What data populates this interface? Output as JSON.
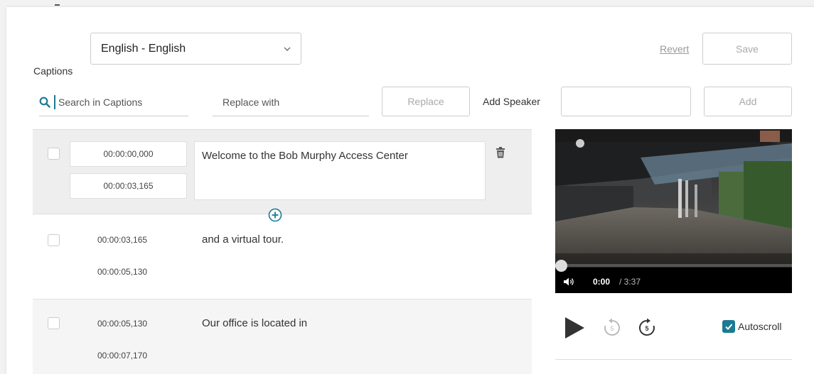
{
  "header": {
    "captions_label": "Captions",
    "language_selected": "English - English",
    "revert_label": "Revert",
    "save_label": "Save"
  },
  "toolbar": {
    "search_placeholder": "Search in Captions",
    "replace_placeholder": "Replace with",
    "replace_label": "Replace",
    "add_speaker_label": "Add Speaker",
    "add_label": "Add"
  },
  "captions": [
    {
      "start": "00:00:00,000",
      "end": "00:00:03,165",
      "text": "Welcome to the Bob Murphy Access Center"
    },
    {
      "start": "00:00:03,165",
      "end": "00:00:05,130",
      "text": "and a virtual tour."
    },
    {
      "start": "00:00:05,130",
      "end": "00:00:07,170",
      "text": "Our office is located in"
    }
  ],
  "player": {
    "current_time": "0:00",
    "total_time": "/ 3:37",
    "progress": 0,
    "autoscroll_label": "Autoscroll",
    "autoscroll_checked": true,
    "rewind_seconds": "5",
    "forward_seconds": "5"
  },
  "colors": {
    "accent": "#1b7a94"
  }
}
